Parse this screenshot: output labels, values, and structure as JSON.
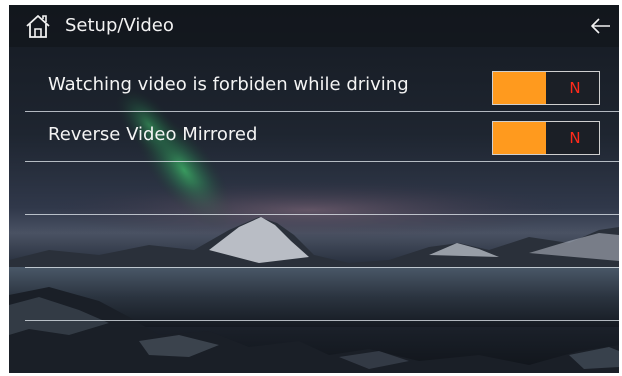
{
  "header": {
    "title": "Setup/Video",
    "home_icon": "home-icon",
    "back_icon": "arrow-left-icon"
  },
  "settings": [
    {
      "label": "Watching video is forbiden while driving",
      "toggle_state": "N",
      "toggle_fill_fraction": 0.5
    },
    {
      "label": "Reverse Video Mirrored",
      "toggle_state": "N",
      "toggle_fill_fraction": 0.5
    }
  ],
  "colors": {
    "toggle_fill": "#ff9a1e",
    "toggle_text": "#ff2a1a",
    "text": "#f4f4f4"
  }
}
